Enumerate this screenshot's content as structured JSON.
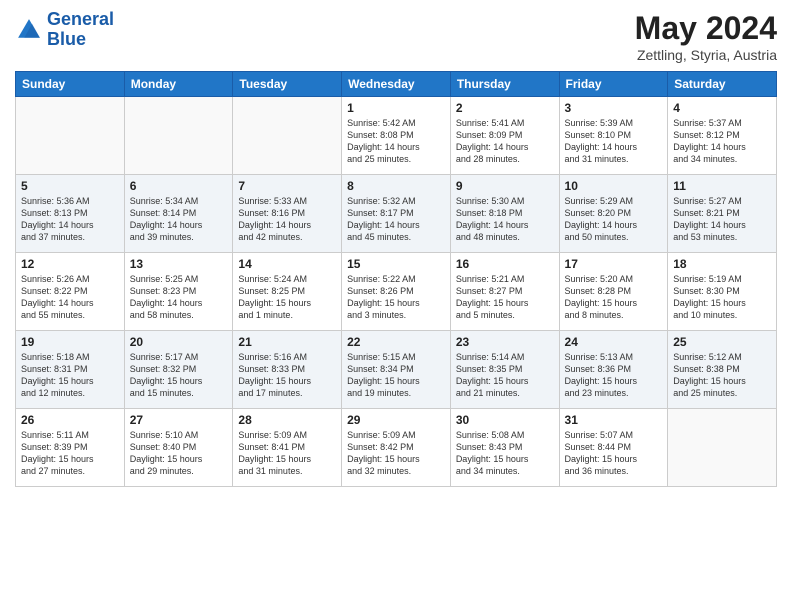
{
  "header": {
    "logo_line1": "General",
    "logo_line2": "Blue",
    "title": "May 2024",
    "subtitle": "Zettling, Styria, Austria"
  },
  "weekdays": [
    "Sunday",
    "Monday",
    "Tuesday",
    "Wednesday",
    "Thursday",
    "Friday",
    "Saturday"
  ],
  "weeks": [
    [
      {
        "day": "",
        "info": ""
      },
      {
        "day": "",
        "info": ""
      },
      {
        "day": "",
        "info": ""
      },
      {
        "day": "1",
        "info": "Sunrise: 5:42 AM\nSunset: 8:08 PM\nDaylight: 14 hours\nand 25 minutes."
      },
      {
        "day": "2",
        "info": "Sunrise: 5:41 AM\nSunset: 8:09 PM\nDaylight: 14 hours\nand 28 minutes."
      },
      {
        "day": "3",
        "info": "Sunrise: 5:39 AM\nSunset: 8:10 PM\nDaylight: 14 hours\nand 31 minutes."
      },
      {
        "day": "4",
        "info": "Sunrise: 5:37 AM\nSunset: 8:12 PM\nDaylight: 14 hours\nand 34 minutes."
      }
    ],
    [
      {
        "day": "5",
        "info": "Sunrise: 5:36 AM\nSunset: 8:13 PM\nDaylight: 14 hours\nand 37 minutes."
      },
      {
        "day": "6",
        "info": "Sunrise: 5:34 AM\nSunset: 8:14 PM\nDaylight: 14 hours\nand 39 minutes."
      },
      {
        "day": "7",
        "info": "Sunrise: 5:33 AM\nSunset: 8:16 PM\nDaylight: 14 hours\nand 42 minutes."
      },
      {
        "day": "8",
        "info": "Sunrise: 5:32 AM\nSunset: 8:17 PM\nDaylight: 14 hours\nand 45 minutes."
      },
      {
        "day": "9",
        "info": "Sunrise: 5:30 AM\nSunset: 8:18 PM\nDaylight: 14 hours\nand 48 minutes."
      },
      {
        "day": "10",
        "info": "Sunrise: 5:29 AM\nSunset: 8:20 PM\nDaylight: 14 hours\nand 50 minutes."
      },
      {
        "day": "11",
        "info": "Sunrise: 5:27 AM\nSunset: 8:21 PM\nDaylight: 14 hours\nand 53 minutes."
      }
    ],
    [
      {
        "day": "12",
        "info": "Sunrise: 5:26 AM\nSunset: 8:22 PM\nDaylight: 14 hours\nand 55 minutes."
      },
      {
        "day": "13",
        "info": "Sunrise: 5:25 AM\nSunset: 8:23 PM\nDaylight: 14 hours\nand 58 minutes."
      },
      {
        "day": "14",
        "info": "Sunrise: 5:24 AM\nSunset: 8:25 PM\nDaylight: 15 hours\nand 1 minute."
      },
      {
        "day": "15",
        "info": "Sunrise: 5:22 AM\nSunset: 8:26 PM\nDaylight: 15 hours\nand 3 minutes."
      },
      {
        "day": "16",
        "info": "Sunrise: 5:21 AM\nSunset: 8:27 PM\nDaylight: 15 hours\nand 5 minutes."
      },
      {
        "day": "17",
        "info": "Sunrise: 5:20 AM\nSunset: 8:28 PM\nDaylight: 15 hours\nand 8 minutes."
      },
      {
        "day": "18",
        "info": "Sunrise: 5:19 AM\nSunset: 8:30 PM\nDaylight: 15 hours\nand 10 minutes."
      }
    ],
    [
      {
        "day": "19",
        "info": "Sunrise: 5:18 AM\nSunset: 8:31 PM\nDaylight: 15 hours\nand 12 minutes."
      },
      {
        "day": "20",
        "info": "Sunrise: 5:17 AM\nSunset: 8:32 PM\nDaylight: 15 hours\nand 15 minutes."
      },
      {
        "day": "21",
        "info": "Sunrise: 5:16 AM\nSunset: 8:33 PM\nDaylight: 15 hours\nand 17 minutes."
      },
      {
        "day": "22",
        "info": "Sunrise: 5:15 AM\nSunset: 8:34 PM\nDaylight: 15 hours\nand 19 minutes."
      },
      {
        "day": "23",
        "info": "Sunrise: 5:14 AM\nSunset: 8:35 PM\nDaylight: 15 hours\nand 21 minutes."
      },
      {
        "day": "24",
        "info": "Sunrise: 5:13 AM\nSunset: 8:36 PM\nDaylight: 15 hours\nand 23 minutes."
      },
      {
        "day": "25",
        "info": "Sunrise: 5:12 AM\nSunset: 8:38 PM\nDaylight: 15 hours\nand 25 minutes."
      }
    ],
    [
      {
        "day": "26",
        "info": "Sunrise: 5:11 AM\nSunset: 8:39 PM\nDaylight: 15 hours\nand 27 minutes."
      },
      {
        "day": "27",
        "info": "Sunrise: 5:10 AM\nSunset: 8:40 PM\nDaylight: 15 hours\nand 29 minutes."
      },
      {
        "day": "28",
        "info": "Sunrise: 5:09 AM\nSunset: 8:41 PM\nDaylight: 15 hours\nand 31 minutes."
      },
      {
        "day": "29",
        "info": "Sunrise: 5:09 AM\nSunset: 8:42 PM\nDaylight: 15 hours\nand 32 minutes."
      },
      {
        "day": "30",
        "info": "Sunrise: 5:08 AM\nSunset: 8:43 PM\nDaylight: 15 hours\nand 34 minutes."
      },
      {
        "day": "31",
        "info": "Sunrise: 5:07 AM\nSunset: 8:44 PM\nDaylight: 15 hours\nand 36 minutes."
      },
      {
        "day": "",
        "info": ""
      }
    ]
  ]
}
